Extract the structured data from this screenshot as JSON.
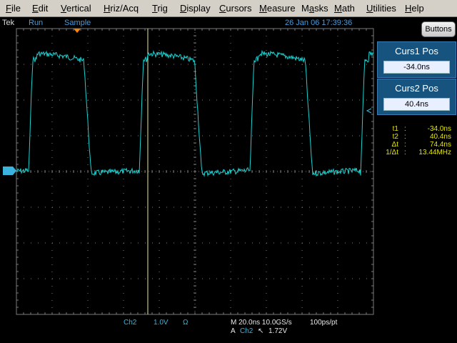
{
  "menu": [
    {
      "label": "File",
      "mn": "F",
      "rest": "ile"
    },
    {
      "label": "Edit",
      "mn": "E",
      "rest": "dit"
    },
    {
      "label": "Vertical",
      "mn": "V",
      "rest": "ertical"
    },
    {
      "label": "Hriz/Acq",
      "mn": "H",
      "rest": "riz/Acq"
    },
    {
      "label": "Trig",
      "mn": "T",
      "rest": "rig"
    },
    {
      "label": "Display",
      "mn": "D",
      "rest": "isplay"
    },
    {
      "label": "Cursors",
      "mn": "C",
      "rest": "ursors"
    },
    {
      "label": "Measure",
      "mn": "M",
      "rest": "easure"
    },
    {
      "label": "Masks",
      "mn": "a",
      "pre": "M",
      "rest": "sks"
    },
    {
      "label": "Math",
      "mn": "M",
      "rest": "ath"
    },
    {
      "label": "Utilities",
      "mn": "U",
      "rest": "tilities"
    },
    {
      "label": "Help",
      "mn": "H",
      "rest": "elp"
    }
  ],
  "status": {
    "brand": "Tek",
    "run_state": "Run",
    "acq_mode": "Sample",
    "datetime": "26 Jan 06 17:39:36"
  },
  "panel": {
    "buttons_label": "Buttons",
    "cursor1": {
      "title": "Curs1 Pos",
      "value": "-34.0ns"
    },
    "cursor2": {
      "title": "Curs2 Pos",
      "value": "40.4ns"
    }
  },
  "readouts": [
    {
      "label": "t1",
      "value": "-34.0ns"
    },
    {
      "label": "t2",
      "value": "40.4ns"
    },
    {
      "label": "Δt",
      "value": "74.4ns"
    },
    {
      "label": "1/Δt",
      "value": "13.44MHz"
    }
  ],
  "bottom": {
    "channel": "Ch2",
    "scale": "1.0V",
    "coupling": "Ω",
    "timebase": "M 20.0ns 10.0GS/s",
    "resolution": "100ps/pt",
    "trig_prefix": "A",
    "trig_channel": "Ch2",
    "trig_slope": "↖",
    "trig_level": "1.72V"
  },
  "channel_marker": "2",
  "colors": {
    "trace": "#19d3d3",
    "cursor": "#e8e8b0",
    "grid": "#7a7a7a",
    "menu_bg": "#d4d0c8",
    "cursor_box": "#16537e",
    "readout": "#e6e600"
  },
  "waveform": {
    "period_ns": 62,
    "duty_high_ns": 31,
    "low_level_div": -0.05,
    "high_level_div": 3.3,
    "volts_per_div": 1.0,
    "ns_per_div": 20.0
  }
}
